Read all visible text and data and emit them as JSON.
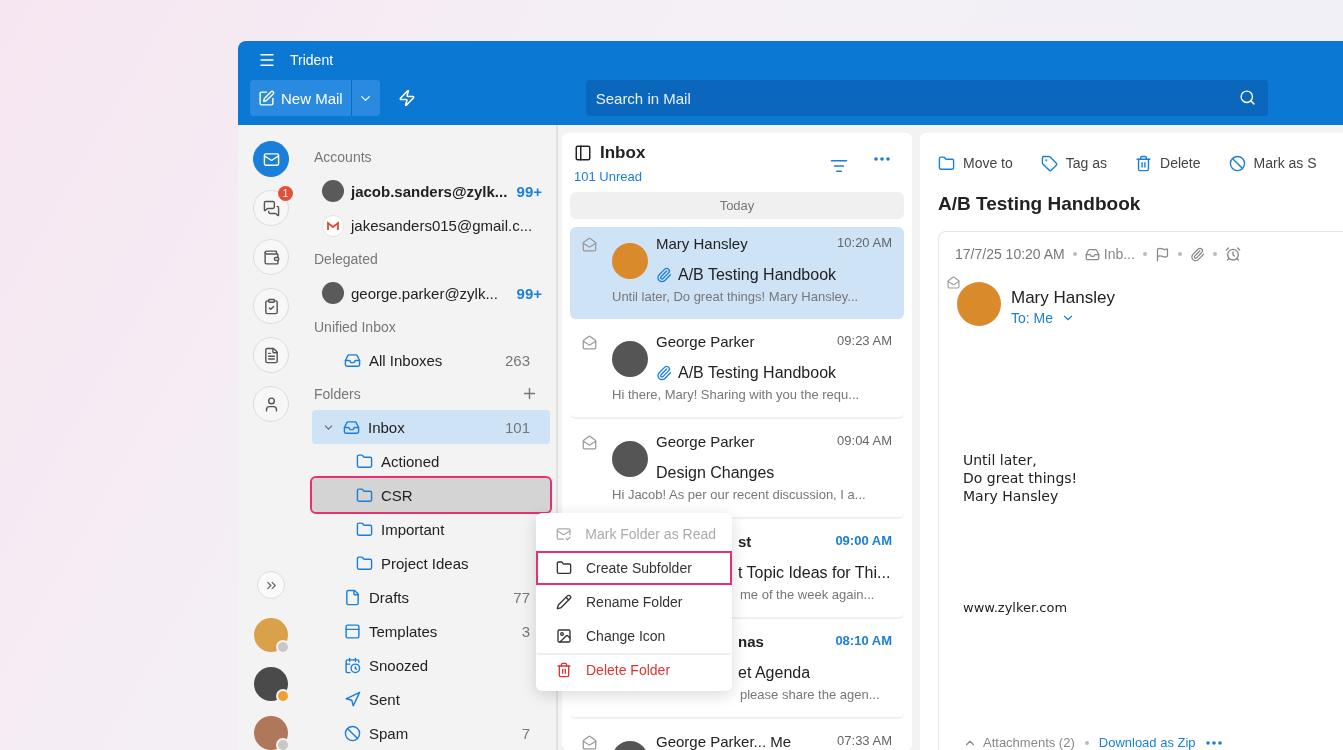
{
  "window": {
    "title": "Trident"
  },
  "toolbar": {
    "new_mail": "New Mail",
    "search": {
      "placeholder": "Search in Mail"
    }
  },
  "rail": [
    {
      "kind": "mail",
      "selected": true
    },
    {
      "kind": "chat",
      "selected": false,
      "badge": "1"
    },
    {
      "kind": "wallet",
      "selected": false
    },
    {
      "kind": "tasks",
      "selected": false
    },
    {
      "kind": "notes",
      "selected": false
    },
    {
      "kind": "contacts",
      "selected": false
    }
  ],
  "rail_people": [
    {
      "color": "#c8c8c8"
    },
    {
      "color": "#f0a030"
    },
    {
      "color": "#c8c8c8"
    }
  ],
  "sections": [
    {
      "kind": "accounts",
      "title": "Accounts",
      "items": [
        {
          "kind": "avatar",
          "label": "jacob.sanders@zylk...",
          "count": "99+",
          "active": true
        },
        {
          "kind": "gmail",
          "label": "jakesanders015@gmail.c...",
          "active": false
        }
      ]
    },
    {
      "kind": "accounts",
      "title": "Delegated",
      "items": [
        {
          "kind": "avatar",
          "label": "george.parker@zylk...",
          "count": "99+",
          "active": false
        }
      ]
    },
    {
      "kind": "folders",
      "title": "Unified Inbox",
      "items": [
        {
          "kind": "inbox",
          "label": "All Inboxes",
          "count": "263",
          "selected": false,
          "highlighted": false
        }
      ]
    },
    {
      "kind": "folders",
      "title": "Folders",
      "add": true,
      "items": [
        {
          "kind": "inbox",
          "label": "Inbox",
          "count": "101",
          "selected": true,
          "highlighted": false,
          "expanded": true,
          "children": [
            {
              "kind": "folder",
              "label": "Actioned",
              "selected": false,
              "highlighted": false
            },
            {
              "kind": "folder",
              "label": "CSR",
              "selected": false,
              "highlighted": true
            },
            {
              "kind": "folder",
              "label": "Important",
              "selected": false,
              "highlighted": false
            },
            {
              "kind": "folder",
              "label": "Project Ideas",
              "selected": false,
              "highlighted": false
            }
          ]
        },
        {
          "kind": "drafts",
          "label": "Drafts",
          "count": "77",
          "selected": false,
          "highlighted": false
        },
        {
          "kind": "templates",
          "label": "Templates",
          "count": "3",
          "selected": false,
          "highlighted": false
        },
        {
          "kind": "snoozed",
          "label": "Snoozed",
          "selected": false,
          "highlighted": false
        },
        {
          "kind": "sent",
          "label": "Sent",
          "selected": false,
          "highlighted": false
        },
        {
          "kind": "spam",
          "label": "Spam",
          "count": "7",
          "selected": false,
          "highlighted": false
        }
      ]
    }
  ],
  "context_menu": [
    {
      "kind": "mark-read",
      "label": "Mark Folder as Read",
      "disabled": true,
      "highlighted": false
    },
    {
      "kind": "folder",
      "label": "Create Subfolder",
      "disabled": false,
      "highlighted": true
    },
    {
      "kind": "pencil",
      "label": "Rename Folder",
      "disabled": false,
      "highlighted": false
    },
    {
      "kind": "image",
      "label": "Change Icon",
      "disabled": false,
      "highlighted": false
    },
    {
      "kind": "trash",
      "label": "Delete Folder",
      "disabled": false,
      "highlighted": false
    }
  ],
  "message_list": {
    "title": "Inbox",
    "unread": "101 Unread",
    "group": "Today",
    "messages": [
      {
        "kind": "full",
        "sender": "Mary Hansley",
        "time": "10:20 AM",
        "subject": "A/B Testing Handbook",
        "preview": "Until later, Do great things! Mary Hansley...",
        "attachment": true,
        "unread": false,
        "selected": true
      },
      {
        "kind": "full",
        "sender": "George Parker",
        "time": "09:23 AM",
        "subject": "A/B Testing Handbook",
        "preview": "Hi there, Mary! Sharing with you the requ...",
        "attachment": true,
        "unread": false,
        "selected": false
      },
      {
        "kind": "full",
        "sender": "George Parker",
        "time": "09:04 AM",
        "subject": "Design Changes",
        "preview": "Hi Jacob! As per our recent discussion, I a...",
        "attachment": false,
        "unread": false,
        "selected": false
      },
      {
        "kind": "covered",
        "sender": "st",
        "time": "09:00 AM",
        "subject": "t Topic Ideas for Thi...",
        "preview": "me of the week again...",
        "attachment": false,
        "unread": true,
        "selected": false
      },
      {
        "kind": "covered",
        "sender": "nas",
        "time": "08:10 AM",
        "subject": "et Agenda",
        "preview": "please share the agen...",
        "attachment": false,
        "unread": true,
        "selected": false
      },
      {
        "kind": "cut",
        "sender": "George Parker... Me",
        "time": "07:33 AM",
        "unread": false,
        "selected": false
      }
    ]
  },
  "reading": {
    "actions": [
      {
        "kind": "folder",
        "label": "Move to"
      },
      {
        "kind": "tag",
        "label": "Tag as"
      },
      {
        "kind": "trash",
        "label": "Delete"
      },
      {
        "kind": "ban",
        "label": "Mark as S"
      }
    ],
    "subject": "A/B Testing Handbook",
    "date": "17/7/25 10:20 AM",
    "folder": "Inb...",
    "sender": "Mary Hansley",
    "to": "To: Me",
    "body": [
      "Until later,",
      "Do great things!",
      "Mary Hansley"
    ],
    "website": "www.zylker.com",
    "attachments": "Attachments (2)",
    "download": "Download as Zip"
  }
}
